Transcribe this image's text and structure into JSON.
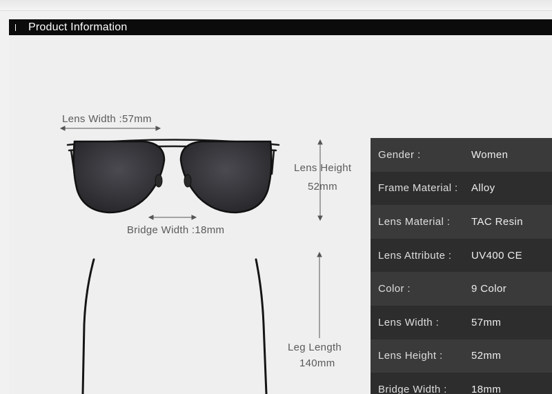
{
  "header": {
    "title": "Product Information"
  },
  "dimensions": {
    "lens_width": "Lens Width :57mm",
    "bridge_width": "Bridge Width :18mm",
    "lens_height_label": "Lens Height",
    "lens_height_value": "52mm",
    "leg_length_label": "Leg Length",
    "leg_length_value": "140mm"
  },
  "specs": [
    {
      "key": "Gender :",
      "value": "Women"
    },
    {
      "key": "Frame Material :",
      "value": "Alloy"
    },
    {
      "key": "Lens Material :",
      "value": "TAC Resin"
    },
    {
      "key": "Lens Attribute :",
      "value": "UV400 CE"
    },
    {
      "key": "Color :",
      "value": "9 Color"
    },
    {
      "key": "Lens Width :",
      "value": "57mm"
    },
    {
      "key": "Lens Height :",
      "value": "52mm"
    },
    {
      "key": "Bridge Width :",
      "value": "18mm"
    }
  ],
  "colors": {
    "header_bg": "#0b0b0b",
    "panel_dark": "#2d2d2d",
    "panel_light": "#3a3a3a",
    "frame": "#1a1a1a",
    "lens": "#2e2e33"
  }
}
